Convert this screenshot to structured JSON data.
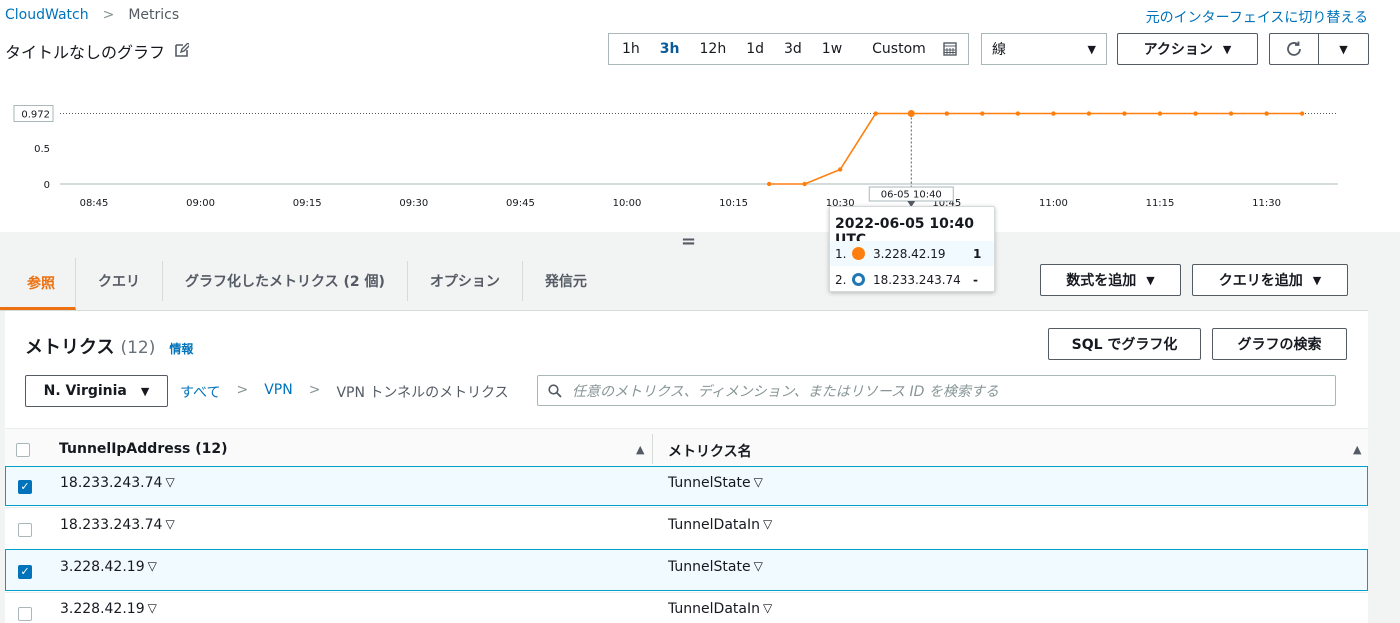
{
  "breadcrumb": {
    "root": "CloudWatch",
    "sep": ">",
    "current": "Metrics"
  },
  "switch_link": "元のインターフェイスに切り替える",
  "graph_title": "タイトルなしのグラフ",
  "time_ranges": [
    "1h",
    "3h",
    "12h",
    "1d",
    "3d",
    "1w"
  ],
  "time_active": "3h",
  "time_custom": "Custom",
  "chart_type_select": "線",
  "actions_label": "アクション",
  "caret": "▼",
  "chart_data": {
    "type": "line",
    "ytick_labels": [
      "0.972",
      "0.5",
      "0"
    ],
    "xtick_labels": [
      "08:45",
      "09:00",
      "09:15",
      "09:30",
      "09:45",
      "10:00",
      "10:15",
      "10:30",
      "10:45",
      "11:00",
      "11:15",
      "11:30"
    ],
    "threshold": 0.972,
    "cursor_label": "06-05 10:40",
    "series": [
      {
        "name": "3.228.42.19",
        "color": "#ff7f0e",
        "points": [
          [
            "10:20",
            0
          ],
          [
            "10:25",
            0
          ],
          [
            "10:30",
            0.2
          ],
          [
            "10:35",
            0.972
          ],
          [
            "10:40",
            0.972
          ],
          [
            "10:45",
            0.972
          ],
          [
            "10:50",
            0.972
          ],
          [
            "10:55",
            0.972
          ],
          [
            "11:00",
            0.972
          ],
          [
            "11:05",
            0.972
          ],
          [
            "11:10",
            0.972
          ],
          [
            "11:15",
            0.972
          ],
          [
            "11:20",
            0.972
          ],
          [
            "11:25",
            0.972
          ],
          [
            "11:30",
            0.972
          ],
          [
            "11:35",
            0.972
          ]
        ]
      }
    ]
  },
  "tooltip": {
    "title": "2022-06-05 10:40 UTC",
    "items": [
      {
        "index": "1.",
        "name": "3.228.42.19",
        "value": "1"
      },
      {
        "index": "2.",
        "name": "18.233.243.74",
        "value": "-"
      }
    ]
  },
  "resize_handle": "=",
  "tabs": [
    "参照",
    "クエリ",
    "グラフ化したメトリクス (2 個)",
    "オプション",
    "発信元"
  ],
  "add_math_label": "数式を追加",
  "add_query_label": "クエリを追加",
  "metrics_title": "メトリクス",
  "metrics_count": "(12)",
  "info_link": "情報",
  "sql_button": "SQL でグラフ化",
  "search_graph_button": "グラフの検索",
  "region_select": "N. Virginia",
  "browse": {
    "all": "すべて",
    "sep": ">",
    "namespace": "VPN",
    "current": "VPN トンネルのメトリクス"
  },
  "search_placeholder": "任意のメトリクス、ディメンション、またはリソース ID を検索する",
  "table": {
    "col1": "TunnelIpAddress (12)",
    "col2": "メトリクス名",
    "sort_icon": "▲",
    "row_caret": "▽",
    "check": "✓",
    "rows": [
      {
        "ip": "18.233.243.74",
        "metric": "TunnelState",
        "selected": true
      },
      {
        "ip": "18.233.243.74",
        "metric": "TunnelDataIn",
        "selected": false
      },
      {
        "ip": "3.228.42.19",
        "metric": "TunnelState",
        "selected": true
      },
      {
        "ip": "3.228.42.19",
        "metric": "TunnelDataIn",
        "selected": false
      }
    ]
  }
}
